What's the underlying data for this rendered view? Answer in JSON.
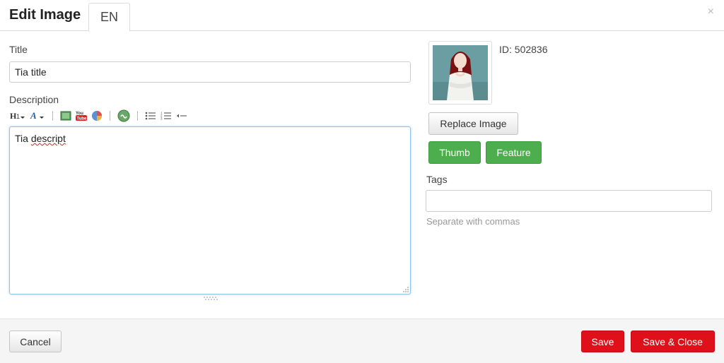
{
  "header": {
    "title": "Edit Image",
    "tab_label": "EN",
    "close_glyph": "×"
  },
  "form": {
    "title_label": "Title",
    "title_value": "Tia title",
    "description_label": "Description",
    "description_plain": "Tia ",
    "description_misspelled": "descript",
    "toolbar_icons": [
      "headings-icon",
      "text-style-icon",
      "image-icon",
      "youtube-icon",
      "chart-icon",
      "link-icon",
      "bulleted-list-icon",
      "numbered-list-icon",
      "indent-icon"
    ]
  },
  "image": {
    "id_text": "ID: 502836",
    "replace_label": "Replace Image",
    "thumb_label": "Thumb",
    "feature_label": "Feature"
  },
  "tags": {
    "label": "Tags",
    "value": "",
    "hint": "Separate with commas"
  },
  "footer": {
    "cancel_label": "Cancel",
    "save_label": "Save",
    "save_close_label": "Save & Close"
  },
  "colors": {
    "green": "#4cae4c",
    "red": "#e0101a",
    "focus_border": "#8cc4ea"
  }
}
